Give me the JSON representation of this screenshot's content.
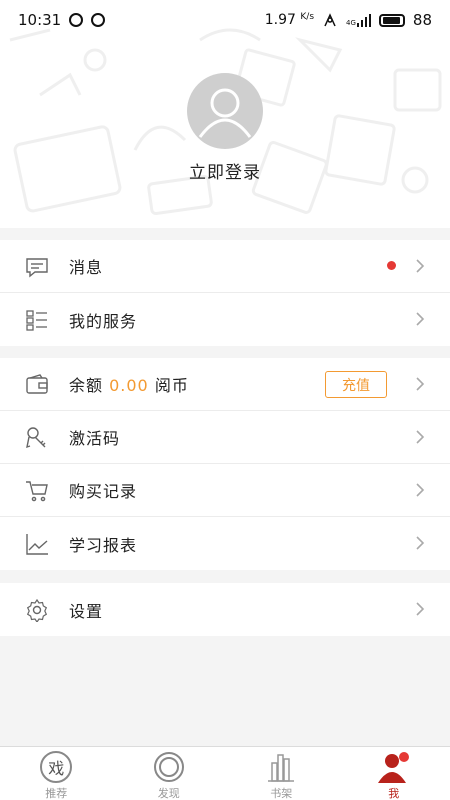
{
  "status_bar": {
    "time": "10:31",
    "net_speed": "1.97",
    "net_unit": "K/s",
    "network": "4G",
    "battery": "88"
  },
  "profile": {
    "login_label": "立即登录"
  },
  "menu": {
    "messages": "消息",
    "my_services": "我的服务",
    "balance_prefix": "余额",
    "balance_value": "0.00",
    "balance_unit": "阅币",
    "recharge": "充值",
    "activation_code": "激活码",
    "purchase_records": "购买记录",
    "study_report": "学习报表",
    "settings": "设置"
  },
  "tabs": {
    "recommend": "推荐",
    "recommend_glyph": "戏",
    "discover": "发现",
    "bookshelf": "书架",
    "me": "我"
  },
  "colors": {
    "accent": "#f39a32",
    "active_tab": "#b8221b",
    "badge": "#e53935"
  }
}
